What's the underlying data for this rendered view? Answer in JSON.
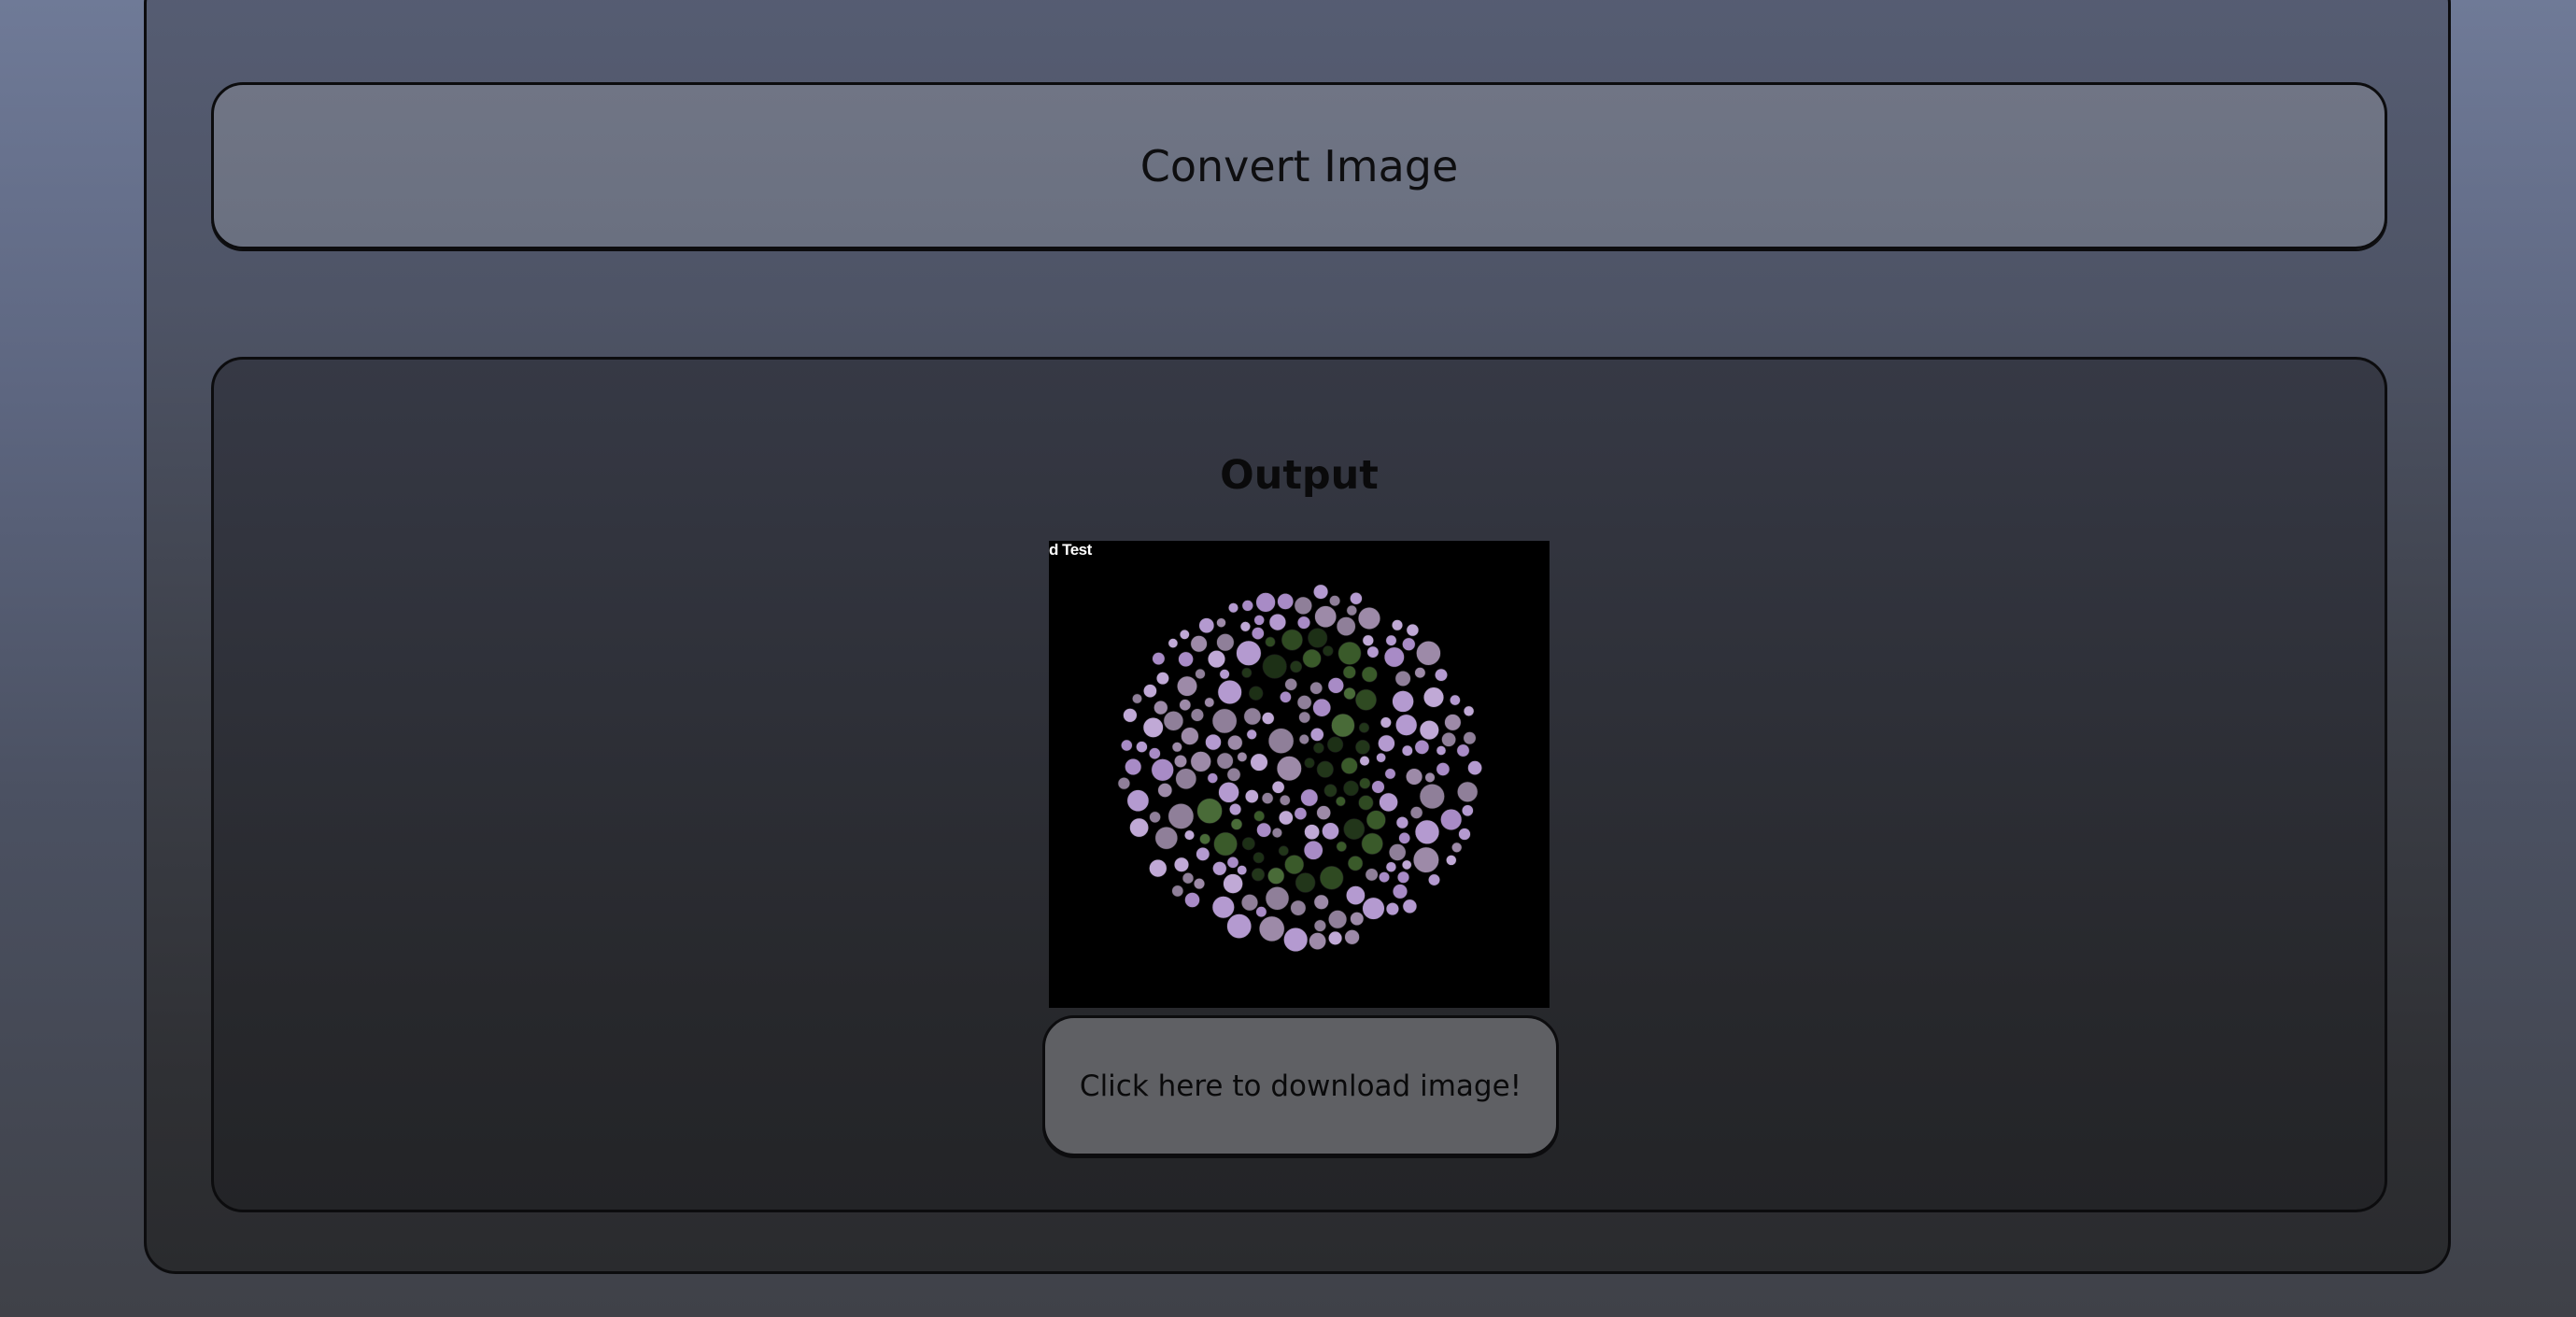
{
  "convert": {
    "label": "Convert Image"
  },
  "output": {
    "title": "Output",
    "image_caption": "d Test",
    "image_content": "color-blindness-test-plate-number-3",
    "download_label": "Click here to download image!"
  },
  "colors": {
    "background_top": "#6f7a97",
    "background_bottom": "#3f4148",
    "panel_border": "#0c0c0e",
    "image_background": "#000000",
    "dot_background_hues": [
      "#b49ad0",
      "#a88bc6",
      "#9d8aa8",
      "#c0a9d6",
      "#8f7f99"
    ],
    "dot_figure_hues": [
      "#2f4a22",
      "#3a5a2a",
      "#22361a",
      "#496b38",
      "#1d3016"
    ]
  }
}
